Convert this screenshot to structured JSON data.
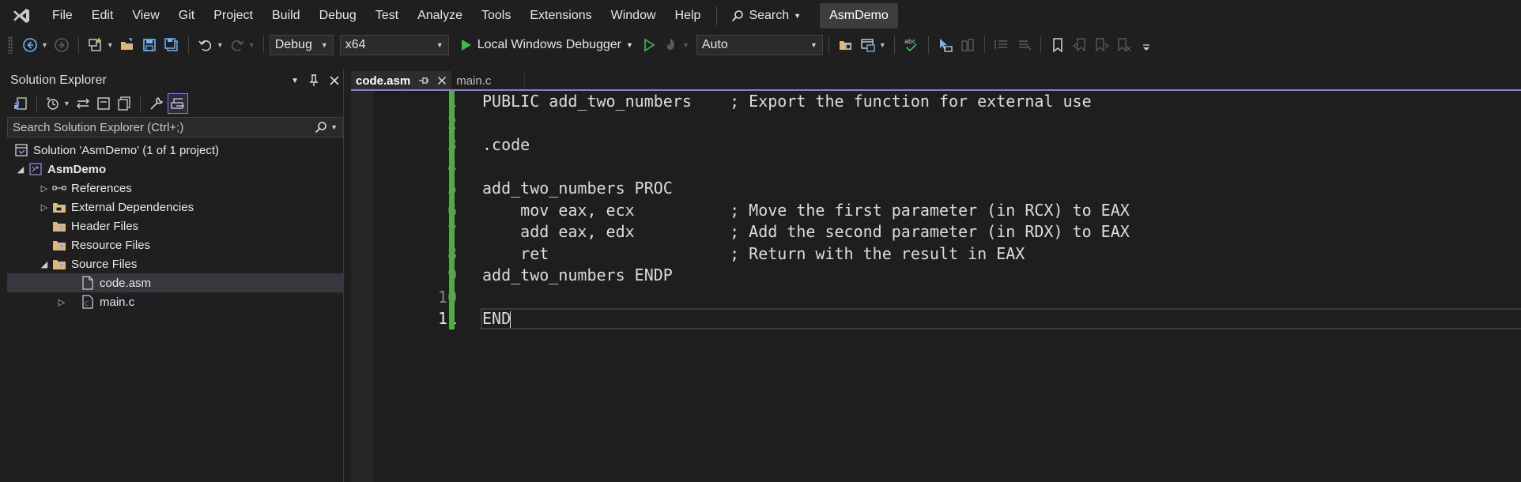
{
  "menu": {
    "items": [
      "File",
      "Edit",
      "View",
      "Git",
      "Project",
      "Build",
      "Debug",
      "Test",
      "Analyze",
      "Tools",
      "Extensions",
      "Window",
      "Help"
    ],
    "search_label": "Search",
    "solution_name": "AsmDemo"
  },
  "toolbar": {
    "configuration": "Debug",
    "platform": "x64",
    "debugger_label": "Local Windows Debugger",
    "stack_frame": "Auto"
  },
  "solution_explorer": {
    "title": "Solution Explorer",
    "search_placeholder": "Search Solution Explorer (Ctrl+;)",
    "tree": {
      "solution": "Solution 'AsmDemo' (1 of 1 project)",
      "project": "AsmDemo",
      "references": "References",
      "external_dependencies": "External Dependencies",
      "header_files": "Header Files",
      "resource_files": "Resource Files",
      "source_files": "Source Files",
      "code_asm": "code.asm",
      "main_c": "main.c"
    }
  },
  "editor": {
    "tabs": [
      {
        "label": "code.asm"
      },
      {
        "label": "main.c"
      }
    ],
    "line_numbers": [
      "1",
      "2",
      "3",
      "4",
      "5",
      "6",
      "7",
      "8",
      "9",
      "10",
      "11"
    ],
    "lines": [
      "PUBLIC add_two_numbers    ; Export the function for external use",
      "",
      ".code",
      "",
      "add_two_numbers PROC",
      "    mov eax, ecx          ; Move the first parameter (in RCX) to EAX",
      "    add eax, edx          ; Add the second parameter (in RDX) to EAX",
      "    ret                   ; Return with the result in EAX",
      "add_two_numbers ENDP",
      "",
      "END"
    ],
    "current_line": 11
  },
  "colors": {
    "accent": "#8f7ad6",
    "change_bar": "#57a64a",
    "background": "#1f1f1f"
  }
}
